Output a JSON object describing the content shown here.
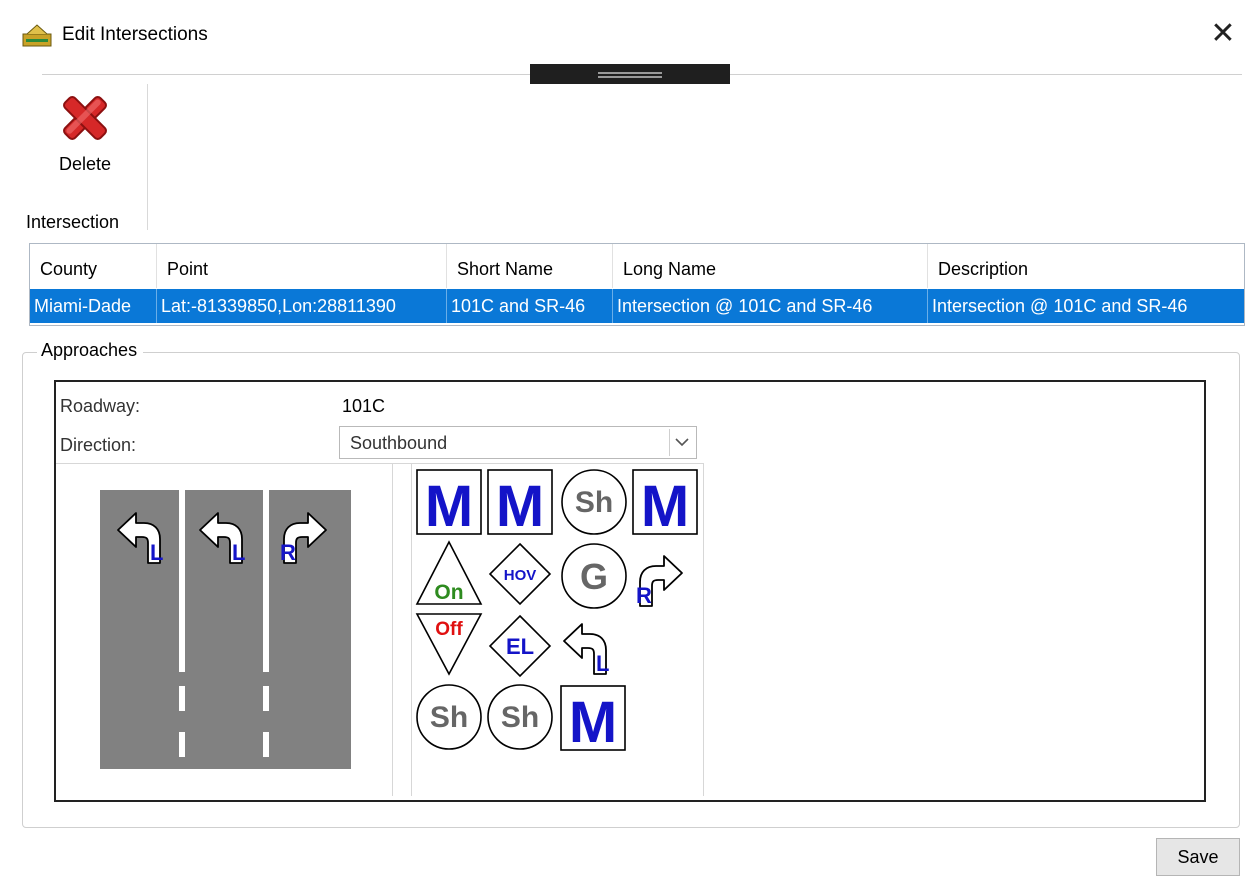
{
  "window": {
    "title": "Edit Intersections",
    "close_glyph": "✕"
  },
  "ribbon": {
    "delete_label": "Delete",
    "group_label": "Intersection"
  },
  "grid": {
    "columns": [
      "County",
      "Point",
      "Short Name",
      "Long Name",
      "Description"
    ],
    "rows": [
      [
        "Miami-Dade",
        "Lat:-81339850,Lon:28811390",
        "101C and SR-46",
        "Intersection @ 101C and SR-46",
        "Intersection @ 101C and SR-46"
      ]
    ],
    "selected_row": 0
  },
  "approaches": {
    "legend": "Approaches",
    "roadway_label": "Roadway:",
    "roadway_value": "101C",
    "direction_label": "Direction:",
    "direction_value": "Southbound",
    "lanes": [
      {
        "icon": "left-turn-arrow-icon",
        "letter": "L"
      },
      {
        "icon": "left-turn-arrow-icon",
        "letter": "L"
      },
      {
        "icon": "right-turn-arrow-icon",
        "letter": "R"
      }
    ],
    "palette_labels": {
      "m": "M",
      "sh": "Sh",
      "on": "On",
      "off": "Off",
      "hov": "HOV",
      "el": "EL",
      "g": "G",
      "r": "R",
      "l": "L"
    }
  },
  "footer": {
    "save_label": "Save"
  },
  "colors": {
    "selection": "#0a78d7",
    "delete_red": "#d62828",
    "sign_blue": "#1414c8",
    "on_green": "#2e8b1f",
    "off_red": "#e01010",
    "road_gray": "#818181",
    "sh_gray": "#666666"
  }
}
